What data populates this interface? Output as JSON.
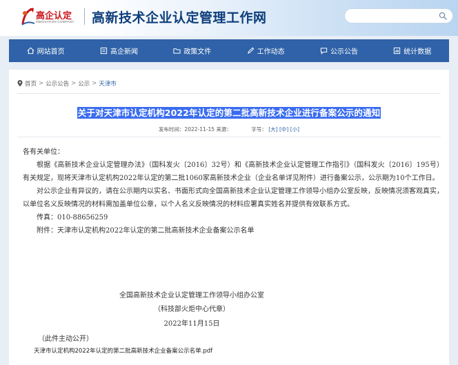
{
  "header": {
    "logo_text": "高企认定",
    "logo_sub": "INNOVATION COMPANY",
    "site_title": "高新技术企业认定管理工作网",
    "search_placeholder": ""
  },
  "nav": [
    {
      "label": "网站首页",
      "icon": "home-icon"
    },
    {
      "label": "高企新闻",
      "icon": "news-icon"
    },
    {
      "label": "政策文件",
      "icon": "folder-icon"
    },
    {
      "label": "工作动态",
      "icon": "pen-icon"
    },
    {
      "label": "公示公告",
      "icon": "chat-icon"
    },
    {
      "label": "统计数据",
      "icon": "chart-icon"
    }
  ],
  "breadcrumb": [
    "首页",
    "公示公告",
    "公示",
    "天津市"
  ],
  "article": {
    "title": "关于对天津市认定机构2022年认定的第二批高新技术企业进行备案公示的通知",
    "publish_label": "发布时间：2022-11-15 来源：",
    "font_label": "字号：",
    "font_sizes": [
      "[大]",
      "[中]",
      "[小]"
    ],
    "greeting": "各有关单位：",
    "para1": "根据《高新技术企业认定管理办法》（国科发火〔2016〕32号）和《高新技术企业认定管理工作指引》（国科发火〔2016〕195号）有关规定，现将天津市认定机构2022年认定的第二批1060家高新技术企业（企业名单详见附件）进行备案公示，公示期为10个工作日。",
    "para2": "对公示企业有异议的，请在公示期内以实名、书面形式向全国高新技术企业认定管理工作领导小组办公室反映，反映情况须客观真实，以单位名义反映情况的材料需加盖单位公章，以个人名义反映情况的材料应署真实姓名并提供有效联系方式。",
    "fax": "传真：010-88656259",
    "attachment": "附件：天津市认定机构2022年认定的第二批高新技术企业备案公示名单",
    "sign_org": "全国高新技术企业认定管理工作领导小组办公室",
    "sign_agent": "（科技部火炬中心代章）",
    "sign_date": "2022年11月15日",
    "open_note": "（此件主动公开）",
    "attachment_link": "天津市认定机构2022年认定的第二批高新技术企业备案公示名单.pdf"
  },
  "colors": {
    "nav_bg": "#2f62a8",
    "title_highlight": "#3a6cf0",
    "brand_red": "#c8161d",
    "title_blue": "#0d3d7a"
  }
}
